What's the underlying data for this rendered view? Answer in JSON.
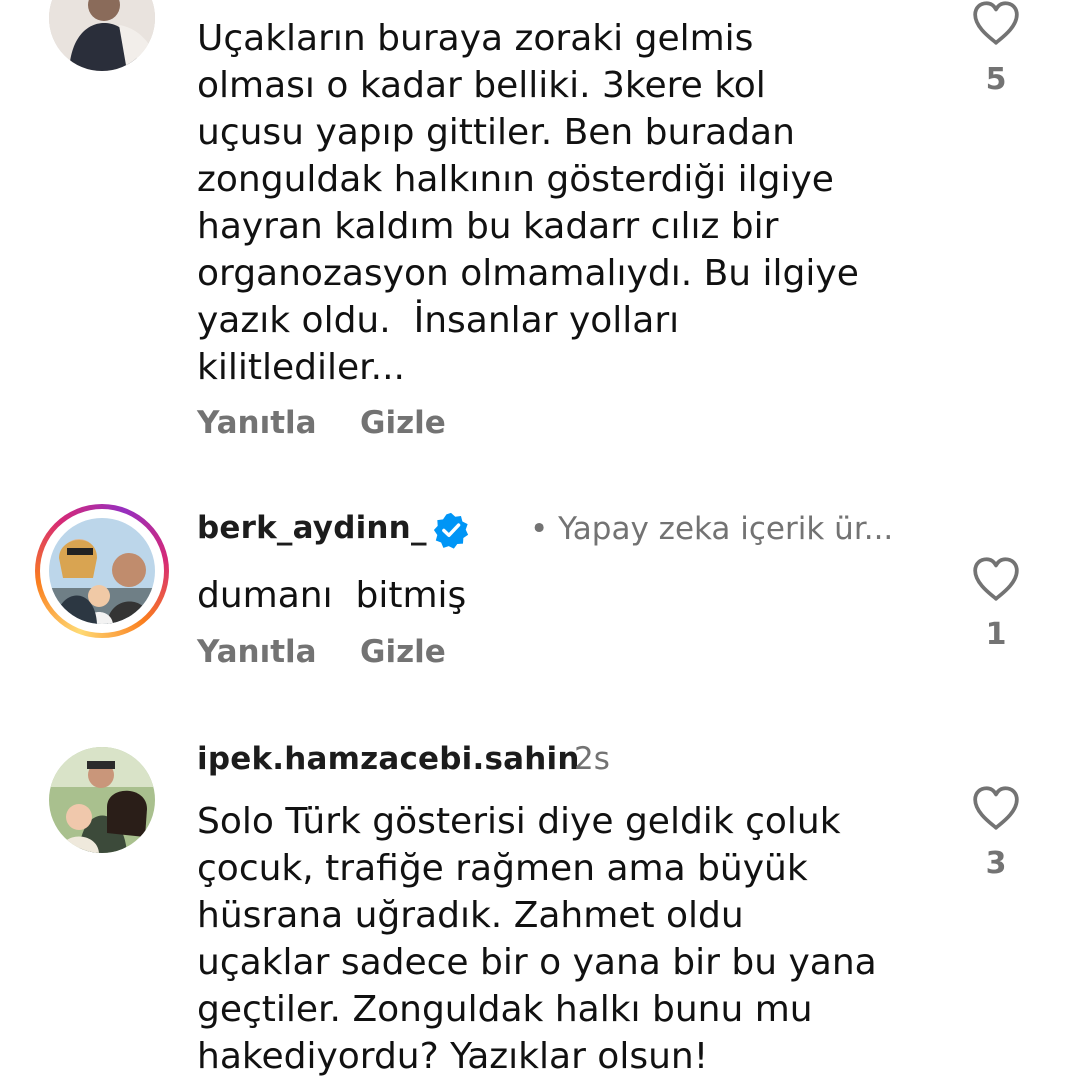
{
  "comments": [
    {
      "username": "",
      "time": "",
      "text": "Uçakların buraya zoraki gelmis\nolması o kadar belliki. 3kere kol\nuçusu yapıp gittiler. Ben buradan\nzonguldak halkının gösterdiği ilgiye\nhayran kaldım bu kadarr cılız bir\norganozasyon olmamalıydı. Bu ilgiye\nyazık oldu.  İnsanlar yolları\nkilitlediler...",
      "reply_label": "Yanıtla",
      "hide_label": "Gizle",
      "likes": "5"
    },
    {
      "username": "berk_aydinn_",
      "verified": true,
      "meta": "• Yapay zeka içerik ür...",
      "text": "dumanı  bitmiş",
      "reply_label": "Yanıtla",
      "hide_label": "Gizle",
      "likes": "1"
    },
    {
      "username": "ipek.hamzacebi.sahin",
      "time": "2s",
      "text": "Solo Türk gösterisi diye geldik çoluk\nçocuk, trafiğe rağmen ama büyük\nhüsrana uğradık. Zahmet oldu\nuçaklar sadece bir o yana bir bu yana\ngeçtiler. Zonguldak halkı bunu mu\nhakediyordu? Yazıklar olsun!",
      "likes": "3"
    }
  ],
  "icons": {
    "like": "heart-outline-icon",
    "verified": "verified-badge-icon"
  },
  "colors": {
    "secondary_text": "#737373",
    "verified_blue": "#0095f6",
    "story_ring_start": "#feda75",
    "story_ring_end": "#d62976"
  }
}
